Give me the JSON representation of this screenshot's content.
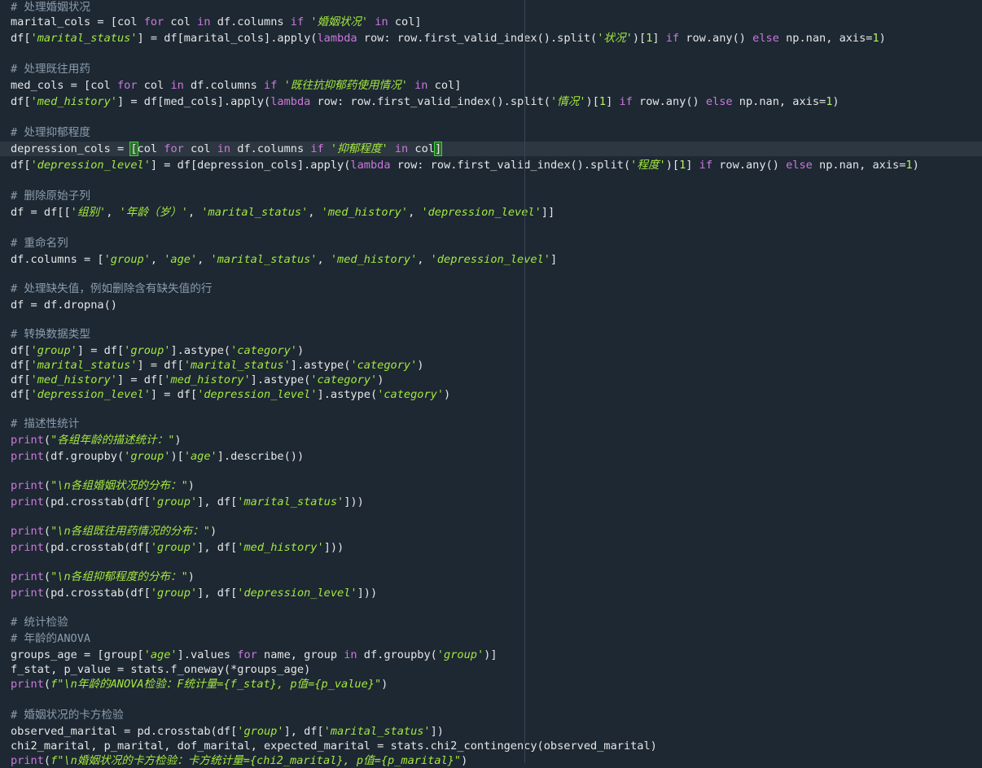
{
  "editor": {
    "language": "python",
    "current_line_index": 9,
    "lines": [
      [
        {
          "t": "cmt",
          "v": "# 处理婚姻状况"
        }
      ],
      [
        {
          "t": "p",
          "v": "marital_cols = [col "
        },
        {
          "t": "kw",
          "v": "for"
        },
        {
          "t": "p",
          "v": " col "
        },
        {
          "t": "kw",
          "v": "in"
        },
        {
          "t": "p",
          "v": " df.columns "
        },
        {
          "t": "kw",
          "v": "if"
        },
        {
          "t": "p",
          "v": " "
        },
        {
          "t": "str",
          "v": "'婚姻状况'"
        },
        {
          "t": "p",
          "v": " "
        },
        {
          "t": "kw",
          "v": "in"
        },
        {
          "t": "p",
          "v": " col]"
        }
      ],
      [
        {
          "t": "p",
          "v": "df["
        },
        {
          "t": "str",
          "v": "'marital_status'"
        },
        {
          "t": "p",
          "v": "] = df[marital_cols].apply("
        },
        {
          "t": "kw",
          "v": "lambda"
        },
        {
          "t": "p",
          "v": " row: row.first_valid_index().split("
        },
        {
          "t": "str",
          "v": "'状况'"
        },
        {
          "t": "p",
          "v": ")["
        },
        {
          "t": "num",
          "v": "1"
        },
        {
          "t": "p",
          "v": "] "
        },
        {
          "t": "kw",
          "v": "if"
        },
        {
          "t": "p",
          "v": " row.any() "
        },
        {
          "t": "kw",
          "v": "else"
        },
        {
          "t": "p",
          "v": " np.nan, axis="
        },
        {
          "t": "num",
          "v": "1"
        },
        {
          "t": "p",
          "v": ")"
        }
      ],
      [],
      [
        {
          "t": "cmt",
          "v": "# 处理既往用药"
        }
      ],
      [
        {
          "t": "p",
          "v": "med_cols = [col "
        },
        {
          "t": "kw",
          "v": "for"
        },
        {
          "t": "p",
          "v": " col "
        },
        {
          "t": "kw",
          "v": "in"
        },
        {
          "t": "p",
          "v": " df.columns "
        },
        {
          "t": "kw",
          "v": "if"
        },
        {
          "t": "p",
          "v": " "
        },
        {
          "t": "str",
          "v": "'既往抗抑郁药使用情况'"
        },
        {
          "t": "p",
          "v": " "
        },
        {
          "t": "kw",
          "v": "in"
        },
        {
          "t": "p",
          "v": " col]"
        }
      ],
      [
        {
          "t": "p",
          "v": "df["
        },
        {
          "t": "str",
          "v": "'med_history'"
        },
        {
          "t": "p",
          "v": "] = df[med_cols].apply("
        },
        {
          "t": "kw",
          "v": "lambda"
        },
        {
          "t": "p",
          "v": " row: row.first_valid_index().split("
        },
        {
          "t": "str",
          "v": "'情况'"
        },
        {
          "t": "p",
          "v": ")["
        },
        {
          "t": "num",
          "v": "1"
        },
        {
          "t": "p",
          "v": "] "
        },
        {
          "t": "kw",
          "v": "if"
        },
        {
          "t": "p",
          "v": " row.any() "
        },
        {
          "t": "kw",
          "v": "else"
        },
        {
          "t": "p",
          "v": " np.nan, axis="
        },
        {
          "t": "num",
          "v": "1"
        },
        {
          "t": "p",
          "v": ")"
        }
      ],
      [],
      [
        {
          "t": "cmt",
          "v": "# 处理抑郁程度"
        }
      ],
      [
        {
          "t": "p",
          "v": "depression_cols = "
        },
        {
          "t": "br",
          "v": "["
        },
        {
          "t": "p",
          "v": "col "
        },
        {
          "t": "kw",
          "v": "for"
        },
        {
          "t": "p",
          "v": " col "
        },
        {
          "t": "kw",
          "v": "in"
        },
        {
          "t": "p",
          "v": " df.columns "
        },
        {
          "t": "kw",
          "v": "if"
        },
        {
          "t": "p",
          "v": " "
        },
        {
          "t": "str",
          "v": "'抑郁程度'"
        },
        {
          "t": "p",
          "v": " "
        },
        {
          "t": "kw",
          "v": "in"
        },
        {
          "t": "p",
          "v": " col"
        },
        {
          "t": "br",
          "v": "]"
        }
      ],
      [
        {
          "t": "p",
          "v": "df["
        },
        {
          "t": "str",
          "v": "'depression_level'"
        },
        {
          "t": "p",
          "v": "] = df[depression_cols].apply("
        },
        {
          "t": "kw",
          "v": "lambda"
        },
        {
          "t": "p",
          "v": " row: row.first_valid_index().split("
        },
        {
          "t": "str",
          "v": "'程度'"
        },
        {
          "t": "p",
          "v": ")["
        },
        {
          "t": "num",
          "v": "1"
        },
        {
          "t": "p",
          "v": "] "
        },
        {
          "t": "kw",
          "v": "if"
        },
        {
          "t": "p",
          "v": " row.any() "
        },
        {
          "t": "kw",
          "v": "else"
        },
        {
          "t": "p",
          "v": " np.nan, axis="
        },
        {
          "t": "num",
          "v": "1"
        },
        {
          "t": "p",
          "v": ")"
        }
      ],
      [],
      [
        {
          "t": "cmt",
          "v": "# 删除原始子列"
        }
      ],
      [
        {
          "t": "p",
          "v": "df = df[["
        },
        {
          "t": "str",
          "v": "'组别'"
        },
        {
          "t": "p",
          "v": ", "
        },
        {
          "t": "str",
          "v": "'年龄（岁）'"
        },
        {
          "t": "p",
          "v": ", "
        },
        {
          "t": "str",
          "v": "'marital_status'"
        },
        {
          "t": "p",
          "v": ", "
        },
        {
          "t": "str",
          "v": "'med_history'"
        },
        {
          "t": "p",
          "v": ", "
        },
        {
          "t": "str",
          "v": "'depression_level'"
        },
        {
          "t": "p",
          "v": "]]"
        }
      ],
      [],
      [
        {
          "t": "cmt",
          "v": "# 重命名列"
        }
      ],
      [
        {
          "t": "p",
          "v": "df.columns = ["
        },
        {
          "t": "str",
          "v": "'group'"
        },
        {
          "t": "p",
          "v": ", "
        },
        {
          "t": "str",
          "v": "'age'"
        },
        {
          "t": "p",
          "v": ", "
        },
        {
          "t": "str",
          "v": "'marital_status'"
        },
        {
          "t": "p",
          "v": ", "
        },
        {
          "t": "str",
          "v": "'med_history'"
        },
        {
          "t": "p",
          "v": ", "
        },
        {
          "t": "str",
          "v": "'depression_level'"
        },
        {
          "t": "p",
          "v": "]"
        }
      ],
      [],
      [
        {
          "t": "cmt",
          "v": "# 处理缺失值，例如删除含有缺失值的行"
        }
      ],
      [
        {
          "t": "p",
          "v": "df = df.dropna()"
        }
      ],
      [],
      [
        {
          "t": "cmt",
          "v": "# 转换数据类型"
        }
      ],
      [
        {
          "t": "p",
          "v": "df["
        },
        {
          "t": "str",
          "v": "'group'"
        },
        {
          "t": "p",
          "v": "] = df["
        },
        {
          "t": "str",
          "v": "'group'"
        },
        {
          "t": "p",
          "v": "].astype("
        },
        {
          "t": "str",
          "v": "'category'"
        },
        {
          "t": "p",
          "v": ")"
        }
      ],
      [
        {
          "t": "p",
          "v": "df["
        },
        {
          "t": "str",
          "v": "'marital_status'"
        },
        {
          "t": "p",
          "v": "] = df["
        },
        {
          "t": "str",
          "v": "'marital_status'"
        },
        {
          "t": "p",
          "v": "].astype("
        },
        {
          "t": "str",
          "v": "'category'"
        },
        {
          "t": "p",
          "v": ")"
        }
      ],
      [
        {
          "t": "p",
          "v": "df["
        },
        {
          "t": "str",
          "v": "'med_history'"
        },
        {
          "t": "p",
          "v": "] = df["
        },
        {
          "t": "str",
          "v": "'med_history'"
        },
        {
          "t": "p",
          "v": "].astype("
        },
        {
          "t": "str",
          "v": "'category'"
        },
        {
          "t": "p",
          "v": ")"
        }
      ],
      [
        {
          "t": "p",
          "v": "df["
        },
        {
          "t": "str",
          "v": "'depression_level'"
        },
        {
          "t": "p",
          "v": "] = df["
        },
        {
          "t": "str",
          "v": "'depression_level'"
        },
        {
          "t": "p",
          "v": "].astype("
        },
        {
          "t": "str",
          "v": "'category'"
        },
        {
          "t": "p",
          "v": ")"
        }
      ],
      [],
      [
        {
          "t": "cmt",
          "v": "# 描述性统计"
        }
      ],
      [
        {
          "t": "builtin",
          "v": "print"
        },
        {
          "t": "p",
          "v": "("
        },
        {
          "t": "str",
          "v": "\"各组年龄的描述统计：\""
        },
        {
          "t": "p",
          "v": ")"
        }
      ],
      [
        {
          "t": "builtin",
          "v": "print"
        },
        {
          "t": "p",
          "v": "(df.groupby("
        },
        {
          "t": "str",
          "v": "'group'"
        },
        {
          "t": "p",
          "v": ")["
        },
        {
          "t": "str",
          "v": "'age'"
        },
        {
          "t": "p",
          "v": "].describe())"
        }
      ],
      [],
      [
        {
          "t": "builtin",
          "v": "print"
        },
        {
          "t": "p",
          "v": "("
        },
        {
          "t": "str",
          "v": "\"\\n各组婚姻状况的分布：\""
        },
        {
          "t": "p",
          "v": ")"
        }
      ],
      [
        {
          "t": "builtin",
          "v": "print"
        },
        {
          "t": "p",
          "v": "(pd.crosstab(df["
        },
        {
          "t": "str",
          "v": "'group'"
        },
        {
          "t": "p",
          "v": "], df["
        },
        {
          "t": "str",
          "v": "'marital_status'"
        },
        {
          "t": "p",
          "v": "]))"
        }
      ],
      [],
      [
        {
          "t": "builtin",
          "v": "print"
        },
        {
          "t": "p",
          "v": "("
        },
        {
          "t": "str",
          "v": "\"\\n各组既往用药情况的分布：\""
        },
        {
          "t": "p",
          "v": ")"
        }
      ],
      [
        {
          "t": "builtin",
          "v": "print"
        },
        {
          "t": "p",
          "v": "(pd.crosstab(df["
        },
        {
          "t": "str",
          "v": "'group'"
        },
        {
          "t": "p",
          "v": "], df["
        },
        {
          "t": "str",
          "v": "'med_history'"
        },
        {
          "t": "p",
          "v": "]))"
        }
      ],
      [],
      [
        {
          "t": "builtin",
          "v": "print"
        },
        {
          "t": "p",
          "v": "("
        },
        {
          "t": "str",
          "v": "\"\\n各组抑郁程度的分布：\""
        },
        {
          "t": "p",
          "v": ")"
        }
      ],
      [
        {
          "t": "builtin",
          "v": "print"
        },
        {
          "t": "p",
          "v": "(pd.crosstab(df["
        },
        {
          "t": "str",
          "v": "'group'"
        },
        {
          "t": "p",
          "v": "], df["
        },
        {
          "t": "str",
          "v": "'depression_level'"
        },
        {
          "t": "p",
          "v": "]))"
        }
      ],
      [],
      [
        {
          "t": "cmt",
          "v": "# 统计检验"
        }
      ],
      [
        {
          "t": "cmt",
          "v": "# 年龄的ANOVA"
        }
      ],
      [
        {
          "t": "p",
          "v": "groups_age = [group["
        },
        {
          "t": "str",
          "v": "'age'"
        },
        {
          "t": "p",
          "v": "].values "
        },
        {
          "t": "kw",
          "v": "for"
        },
        {
          "t": "p",
          "v": " name, group "
        },
        {
          "t": "kw",
          "v": "in"
        },
        {
          "t": "p",
          "v": " df.groupby("
        },
        {
          "t": "str",
          "v": "'group'"
        },
        {
          "t": "p",
          "v": ")]"
        }
      ],
      [
        {
          "t": "p",
          "v": "f_stat, p_value = stats.f_oneway(*groups_age)"
        }
      ],
      [
        {
          "t": "builtin",
          "v": "print"
        },
        {
          "t": "p",
          "v": "("
        },
        {
          "t": "str",
          "v": "f\"\\n年龄的ANOVA检验：F统计量={f_stat}, p值={p_value}\""
        },
        {
          "t": "p",
          "v": ")"
        }
      ],
      [],
      [
        {
          "t": "cmt",
          "v": "# 婚姻状况的卡方检验"
        }
      ],
      [
        {
          "t": "p",
          "v": "observed_marital = pd.crosstab(df["
        },
        {
          "t": "str",
          "v": "'group'"
        },
        {
          "t": "p",
          "v": "], df["
        },
        {
          "t": "str",
          "v": "'marital_status'"
        },
        {
          "t": "p",
          "v": "])"
        }
      ],
      [
        {
          "t": "p",
          "v": "chi2_marital, p_marital, dof_marital, expected_marital = stats.chi2_contingency(observed_marital)"
        }
      ],
      [
        {
          "t": "builtin",
          "v": "print"
        },
        {
          "t": "p",
          "v": "("
        },
        {
          "t": "str",
          "v": "f\"\\n婚姻状况的卡方检验：卡方统计量={chi2_marital}, p值={p_marital}\""
        },
        {
          "t": "p",
          "v": ")"
        }
      ]
    ]
  }
}
